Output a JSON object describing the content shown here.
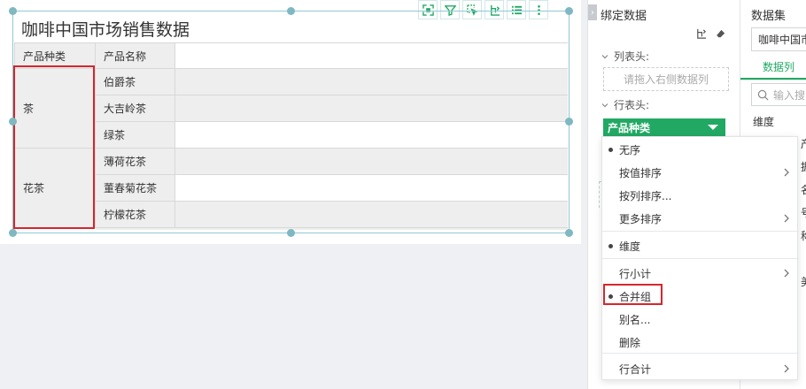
{
  "canvas": {
    "title": "咖啡中国市场销售数据",
    "table": {
      "header": [
        "产品种类",
        "产品名称"
      ],
      "groups": [
        {
          "category": "茶",
          "products": [
            "伯爵茶",
            "大吉岭茶",
            "绿茶"
          ]
        },
        {
          "category": "花茶",
          "products": [
            "薄荷花茶",
            "董春菊花茶",
            "柠檬花茶"
          ]
        }
      ]
    },
    "toolbar_icons": [
      "fullscreen-icon",
      "filter-icon",
      "select-icon",
      "export-icon",
      "list-icon",
      "more-icon"
    ]
  },
  "bind_panel": {
    "title": "绑定数据",
    "column_header_label": "列表头:",
    "column_drop_placeholder": "请拖入右侧数据列",
    "row_header_label": "行表头:",
    "row_field": "产品种类"
  },
  "data_panel": {
    "dataset_label": "数据集",
    "dataset_value": "咖啡中国市场",
    "tab_columns": "数据列",
    "search_placeholder": "输入搜",
    "dimension_label": "维度",
    "peek_texts": [
      "产",
      "据",
      "名",
      "号",
      "称",
      "美"
    ]
  },
  "menu": {
    "items": [
      {
        "label": "无序",
        "selected": true,
        "submenu": false
      },
      {
        "label": "按值排序",
        "selected": false,
        "submenu": true
      },
      {
        "label": "按列排序...",
        "selected": false,
        "submenu": false
      },
      {
        "label": "更多排序",
        "selected": false,
        "submenu": true
      },
      {
        "label": "维度",
        "selected": true,
        "submenu": false
      },
      {
        "label": "行小计",
        "selected": false,
        "submenu": true
      },
      {
        "label": "合并组",
        "selected": true,
        "submenu": false
      },
      {
        "label": "别名...",
        "selected": false,
        "submenu": false
      },
      {
        "label": "删除",
        "selected": false,
        "submenu": false
      },
      {
        "label": "行合计",
        "selected": false,
        "submenu": true
      }
    ]
  },
  "colors": {
    "accent_green": "#21a964",
    "highlight_red": "#d6262d",
    "selection_teal": "#7fb8c0"
  }
}
